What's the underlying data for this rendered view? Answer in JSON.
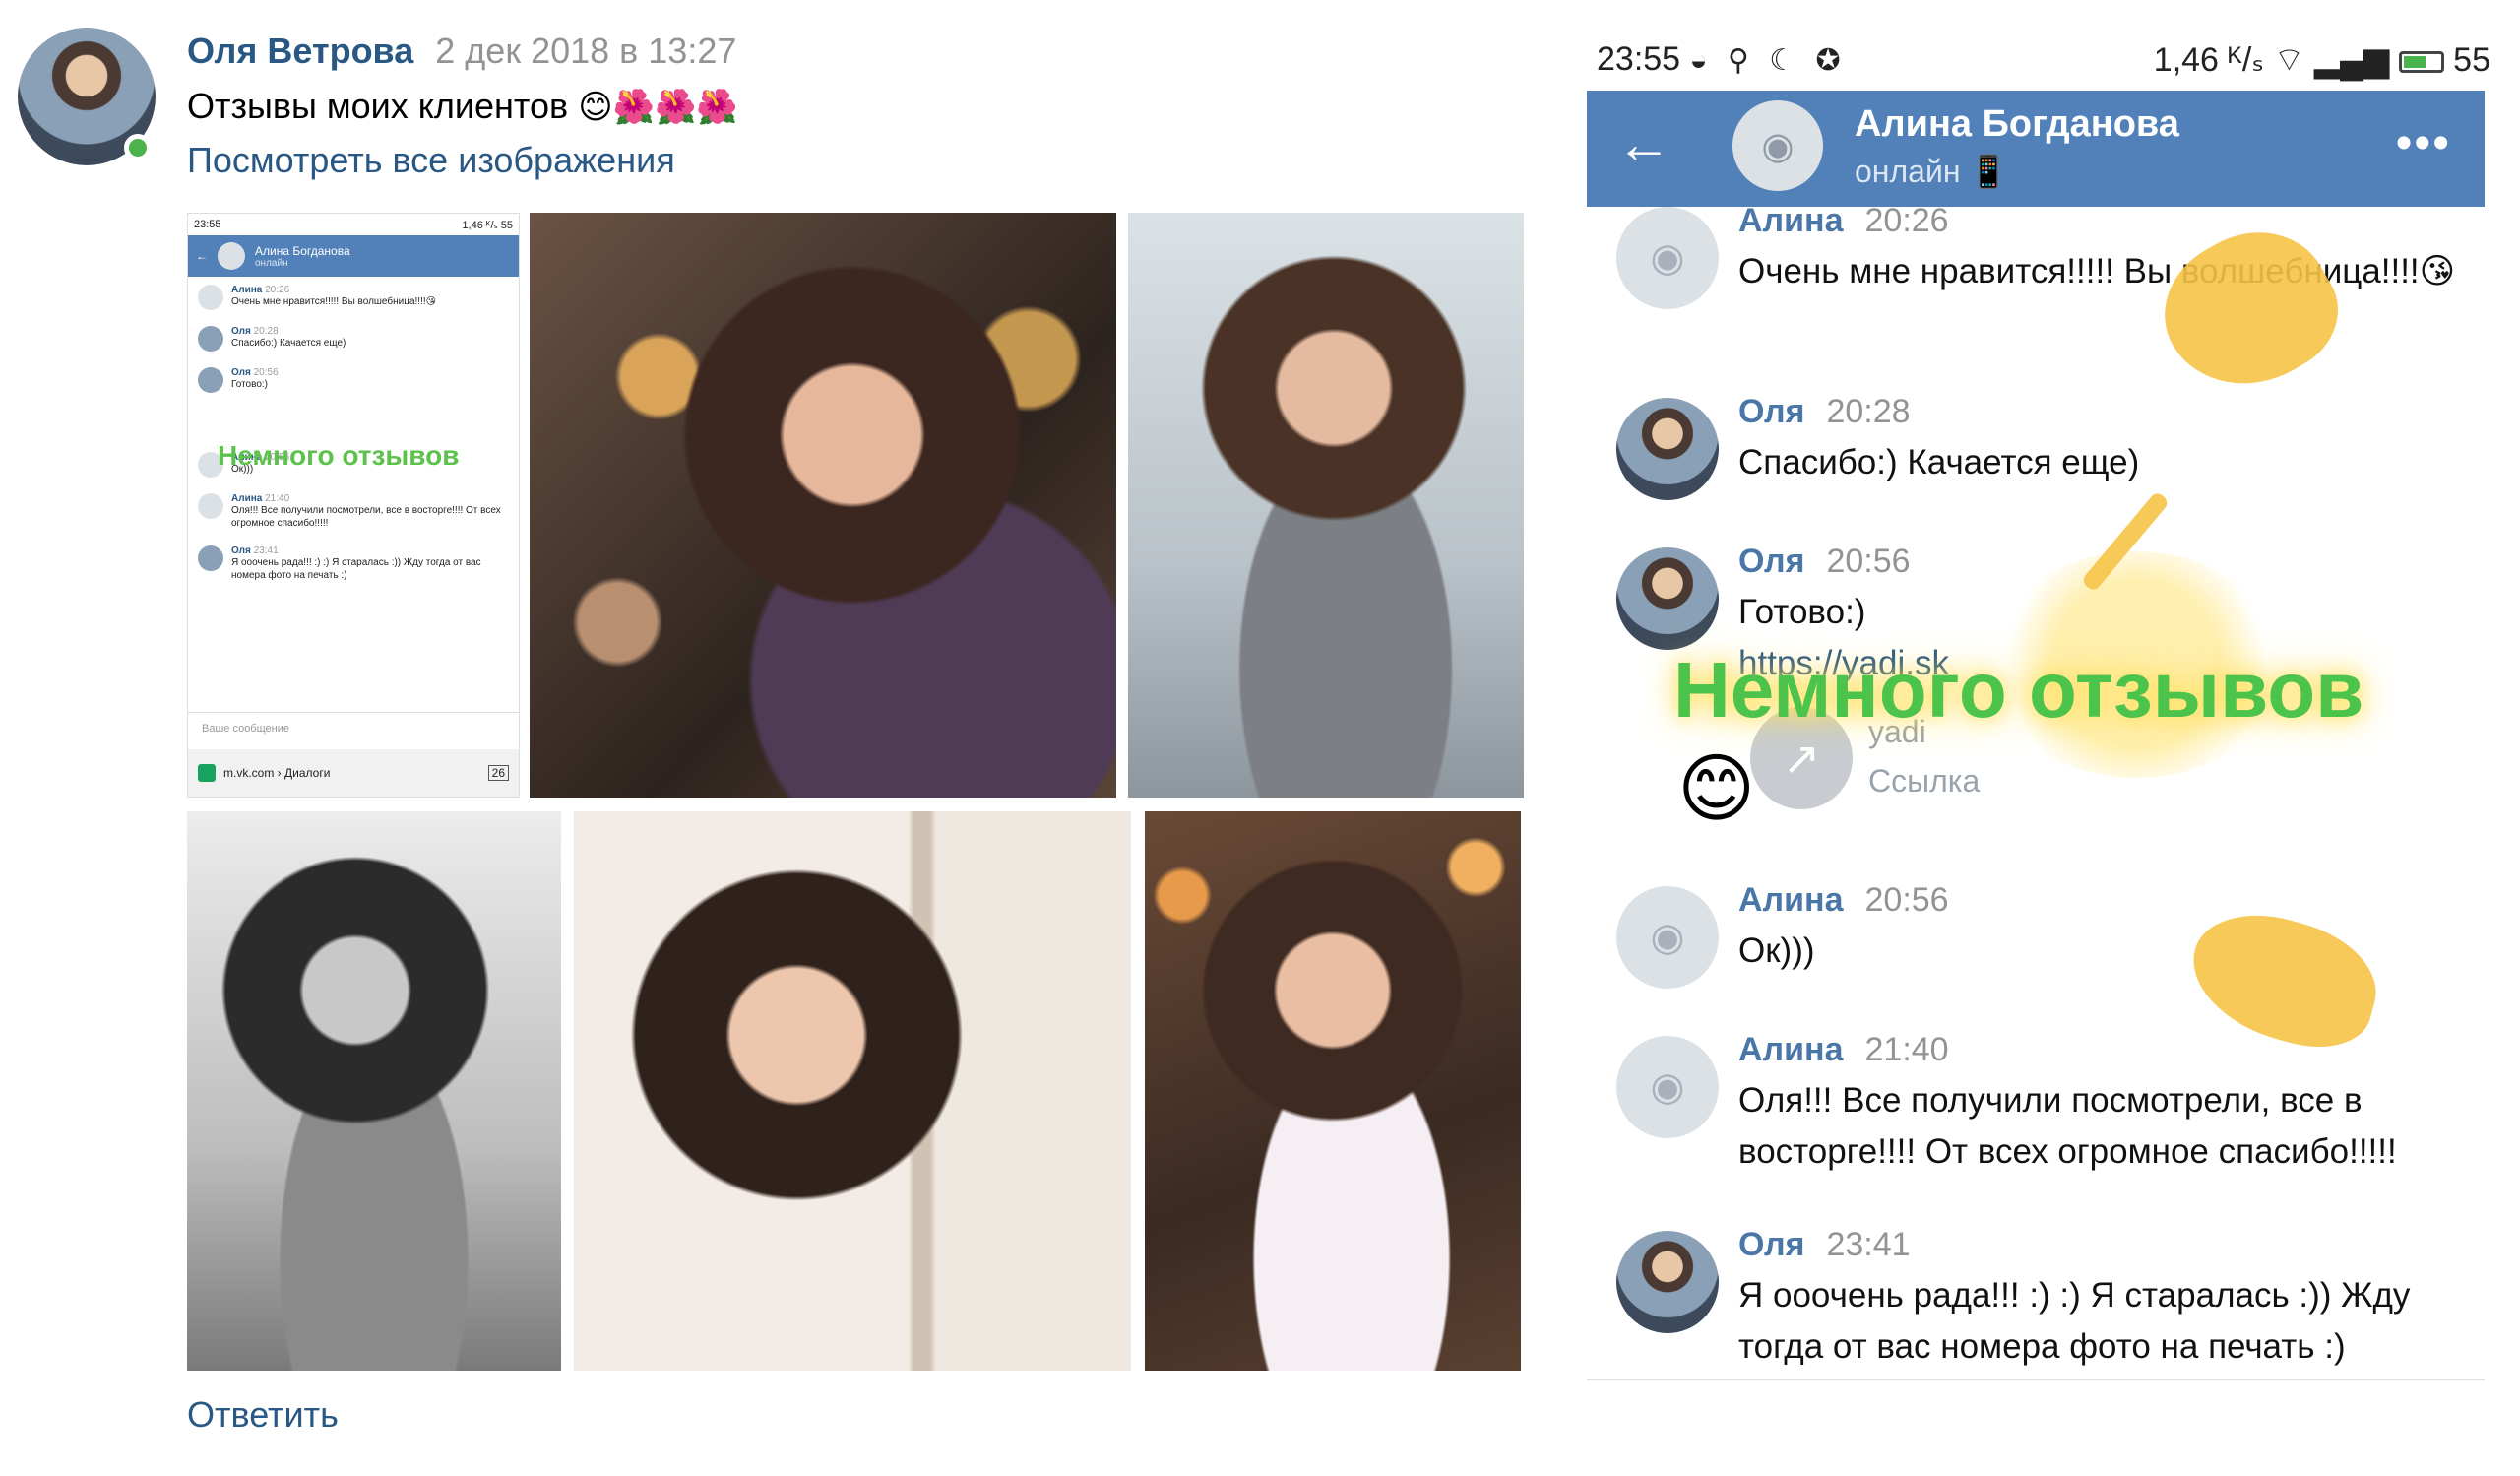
{
  "post": {
    "author": "Оля Ветрова",
    "date": "2 дек 2018 в 13:27",
    "text": "Отзывы моих клиентов",
    "text_emojis": "😊🌺🌺🌺",
    "show_all_link": "Посмотреть все изображения",
    "reply_link": "Ответить"
  },
  "mini_screenshot": {
    "status_time": "23:55",
    "status_right": "1,46 ᴷ/ₛ  55",
    "header_name": "Алина Богданова",
    "header_status": "онлайн",
    "messages": [
      {
        "name": "Алина",
        "time": "20:26",
        "text": "Очень мне нравится!!!!! Вы волшебница!!!!😘"
      },
      {
        "name": "Оля",
        "time": "20:28",
        "text": "Спасибо:) Качается еще)"
      },
      {
        "name": "Оля",
        "time": "20:56",
        "text": "Готово:)"
      },
      {
        "name": "Алина",
        "time": "20:56",
        "text": "Ок)))"
      },
      {
        "name": "Алина",
        "time": "21:40",
        "text": "Оля!!! Все получили посмотрели, все в восторге!!!! От всех огромное спасибо!!!!!"
      },
      {
        "name": "Оля",
        "time": "23:41",
        "text": "Я ооочень рада!!! :) :) Я старалась :)) Жду тогда от вас номера фото на печать :)"
      }
    ],
    "overlay": "Немного отзывов",
    "input_placeholder": "Ваше сообщение",
    "url": "m.vk.com › Диалоги",
    "tabs_count": "26"
  },
  "phone": {
    "status_time": "23:55",
    "status_icons": "◒ ⚲ ☾ ✪",
    "status_speed": "1,46 ᴷ/ₛ",
    "status_battery": "55",
    "contact_name": "Алина Богданова",
    "contact_status": "онлайн 📱",
    "overlay_text": "Немного  отзывов",
    "overlay_emoji": "😊",
    "messages": [
      {
        "name": "Алина",
        "time": "20:26",
        "text": "Очень мне нравится!!!!! Вы волшебница!!!!😘"
      },
      {
        "name": "Оля",
        "time": "20:28",
        "text": "Спасибо:) Качается еще)"
      },
      {
        "name": "Оля",
        "time": "20:56",
        "text": "Готово:)",
        "link": "https://yadi.sk",
        "attach_title": "yadi",
        "attach_sub": "Ссылка"
      },
      {
        "name": "Алина",
        "time": "20:56",
        "text": "Ок)))"
      },
      {
        "name": "Алина",
        "time": "21:40",
        "text": "Оля!!! Все получили посмотрели, все в восторге!!!! От всех огромное спасибо!!!!!"
      },
      {
        "name": "Оля",
        "time": "23:41",
        "text": "Я ооочень рада!!! :) :) Я старалась :)) Жду тогда от вас номера фото на печать :)"
      }
    ]
  },
  "colors": {
    "vk_blue": "#5181b8",
    "link": "#2a5885",
    "online": "#4bb34b",
    "overlay_green": "#4cc34a",
    "scribble": "#f6c347"
  }
}
